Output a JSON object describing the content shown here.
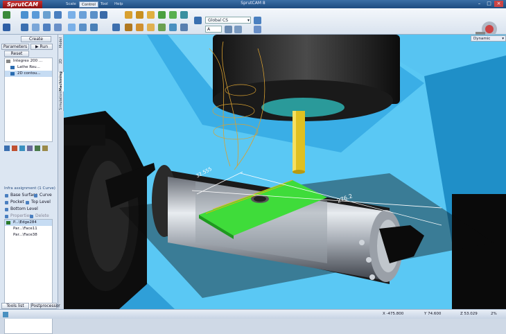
{
  "app": {
    "logo": "SprutCAM",
    "window_title": "SprutCAM 8"
  },
  "menu": [
    {
      "label": "Scale"
    },
    {
      "label": "Control"
    },
    {
      "label": "Tool"
    },
    {
      "label": "Help"
    }
  ],
  "toolbar": {
    "coordinate_system": "Global CS",
    "field_value": "A"
  },
  "left_panel": {
    "create_label": "Create",
    "parameters_tab": "Parameters",
    "run_label": "Run",
    "reset_label": "Reset",
    "operations": [
      "Integrex 200 ...",
      "Lathe Rou...",
      "2D contou..."
    ],
    "vertical_tabs": [
      "Model",
      "2D Geometry",
      "Machining",
      "Simulation"
    ],
    "infra_label": "Infra assignment  (1 Curve)",
    "options": [
      "Base Surface",
      "Curve",
      "Pocket",
      "Top Level",
      "Bottom Level",
      "Properties",
      "Delete"
    ],
    "faces": [
      "P...\\Edge284",
      "Par...\\Face11",
      "Par...\\Face38"
    ],
    "bottom_tabs": [
      "Tools list",
      "Postprocessor"
    ]
  },
  "viewport": {
    "mode_label": "Dynamic",
    "dimension_1": "32.555",
    "dimension_2": "276.2"
  },
  "status": {
    "x": "X -475.800",
    "y": "Y 74.600",
    "z": "Z 53.029",
    "zoom": "2%"
  },
  "colors": {
    "accent": "#1d4b80",
    "viewport_bg": "#57c4f2",
    "green_face": "#3fdc3a"
  }
}
